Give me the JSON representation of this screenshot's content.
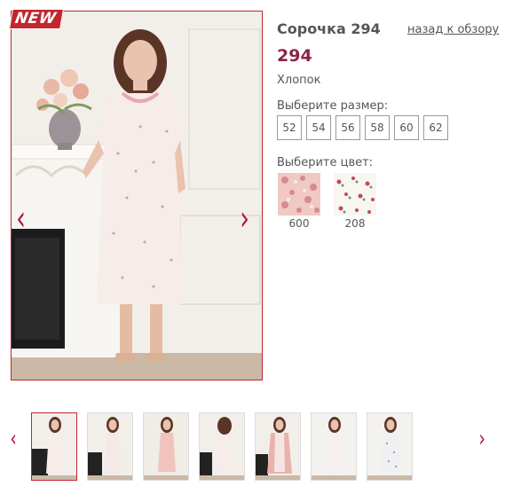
{
  "product": {
    "badge": "NEW",
    "title": "Сорочка 294",
    "back_link": "назад к обзору",
    "price": "294",
    "material": "Хлопок",
    "size_label": "Выберите размер:",
    "sizes": [
      "52",
      "54",
      "56",
      "58",
      "60",
      "62"
    ],
    "color_label": "Выберите цвет:",
    "colors": [
      {
        "code": "600",
        "swatch": "pink-floral-pattern"
      },
      {
        "code": "208",
        "swatch": "white-floral-pattern"
      }
    ]
  },
  "navigation": {
    "prev_icon": "‹",
    "next_icon": "›",
    "thumb_prev_icon": "‹",
    "thumb_next_icon": "›"
  },
  "gallery": {
    "thumbnail_count": 7,
    "active_index": 0
  },
  "theme": {
    "accent": "#c1272d",
    "price_color": "#8b2348",
    "arrow_color": "#b5123a"
  }
}
